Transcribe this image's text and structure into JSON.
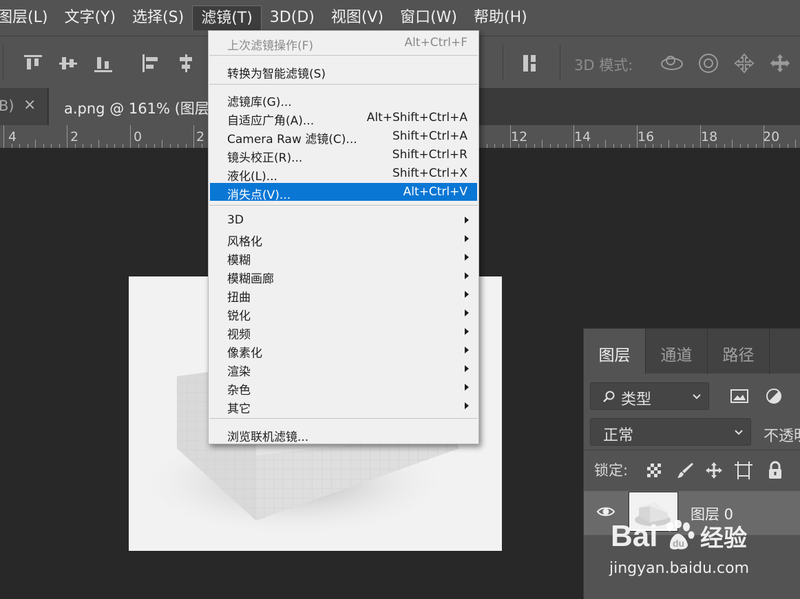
{
  "menubar": {
    "items": [
      "图层(L)",
      "文字(Y)",
      "选择(S)",
      "滤镜(T)",
      "3D(D)",
      "视图(V)",
      "窗口(W)",
      "帮助(H)"
    ],
    "active_index": 3
  },
  "options_bar": {
    "mode_3d_label": "3D 模式:",
    "icons": [
      "align-top-icon",
      "align-vertical-center-icon",
      "align-bottom-icon",
      "align-left-icon",
      "align-horizontal-center-icon",
      "distribute-icon",
      "rotate-3d-icon",
      "roll-3d-icon",
      "drag-3d-icon",
      "slide-3d-icon"
    ]
  },
  "tabs": {
    "previous_label": "B)",
    "close_symbol": "×",
    "active_label": "a.png @ 161% (图层"
  },
  "ruler": {
    "labels": [
      "4",
      "2",
      "0",
      "2",
      "12",
      "14",
      "16",
      "18",
      "20"
    ]
  },
  "filter_menu": {
    "last_filter": {
      "label": "上次滤镜操作(F)",
      "shortcut": "Alt+Ctrl+F"
    },
    "convert_smart": {
      "label": "转换为智能滤镜(S)"
    },
    "group_main": [
      {
        "label": "滤镜库(G)...",
        "shortcut": ""
      },
      {
        "label": "自适应广角(A)...",
        "shortcut": "Alt+Shift+Ctrl+A"
      },
      {
        "label": "Camera Raw 滤镜(C)...",
        "shortcut": "Shift+Ctrl+A"
      },
      {
        "label": "镜头校正(R)...",
        "shortcut": "Shift+Ctrl+R"
      },
      {
        "label": "液化(L)...",
        "shortcut": "Shift+Ctrl+X"
      },
      {
        "label": "消失点(V)...",
        "shortcut": "Alt+Ctrl+V"
      }
    ],
    "highlighted_index": 5,
    "submenus": [
      "3D",
      "风格化",
      "模糊",
      "模糊画廊",
      "扭曲",
      "锐化",
      "视频",
      "像素化",
      "渲染",
      "杂色",
      "其它"
    ],
    "browse_online": {
      "label": "浏览联机滤镜..."
    }
  },
  "layers_panel": {
    "tabs": [
      "图层",
      "通道",
      "路径"
    ],
    "filter_kind": "类型",
    "blend_mode": "正常",
    "opacity_label": "不透明",
    "lock_label": "锁定:",
    "layer_name": "图层 0"
  },
  "watermark": {
    "brand": "Baidu经验",
    "url": "jingyan.baidu.com"
  },
  "colors": {
    "highlight": "#0a77d5",
    "panel": "#535353",
    "canvas": "#282828"
  }
}
